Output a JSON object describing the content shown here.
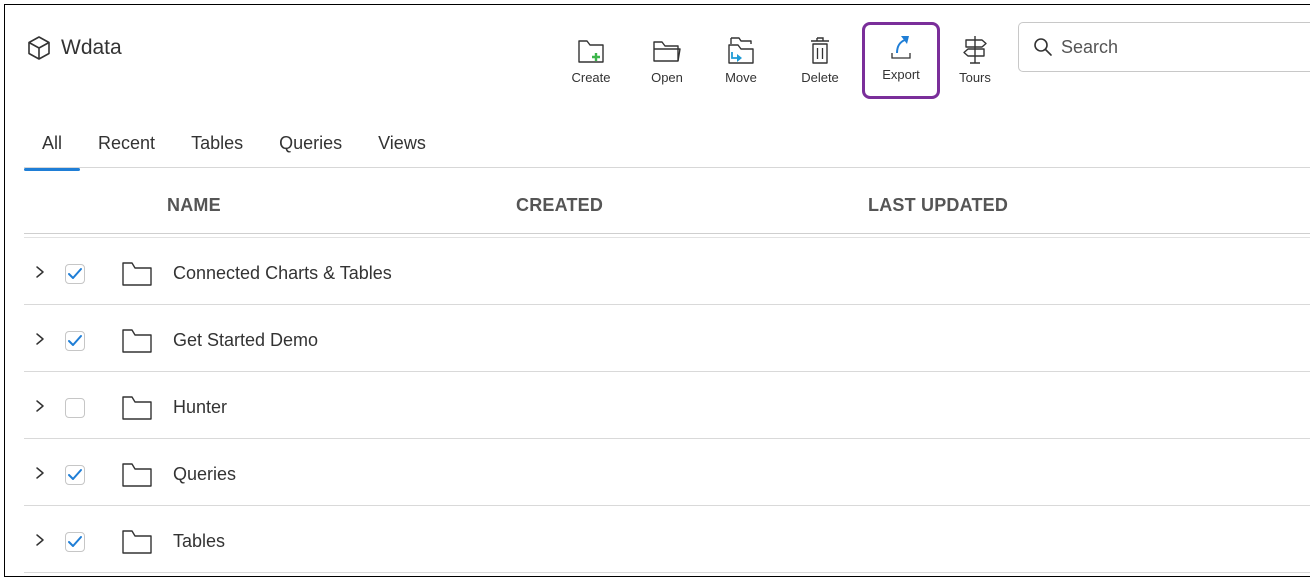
{
  "app": {
    "title": "Wdata",
    "logo_icon": "cube-icon"
  },
  "toolbar": {
    "items": [
      {
        "id": "create",
        "label": "Create",
        "icon": "folder-plus-icon"
      },
      {
        "id": "open",
        "label": "Open",
        "icon": "folder-open-icon"
      },
      {
        "id": "move",
        "label": "Move",
        "icon": "folder-move-icon"
      },
      {
        "id": "delete",
        "label": "Delete",
        "icon": "trash-icon"
      },
      {
        "id": "export",
        "label": "Export",
        "icon": "export-icon",
        "highlighted": true
      },
      {
        "id": "tours",
        "label": "Tours",
        "icon": "signpost-icon"
      }
    ],
    "highlight_color": "#7a2e9a"
  },
  "search": {
    "placeholder": "Search",
    "value": ""
  },
  "tabs": [
    {
      "label": "All",
      "active": true
    },
    {
      "label": "Recent",
      "active": false
    },
    {
      "label": "Tables",
      "active": false
    },
    {
      "label": "Queries",
      "active": false
    },
    {
      "label": "Views",
      "active": false
    }
  ],
  "table": {
    "columns": [
      "NAME",
      "CREATED",
      "LAST UPDATED"
    ],
    "rows": [
      {
        "name": "Connected Charts & Tables",
        "checked": true,
        "created": "",
        "updated": ""
      },
      {
        "name": "Get Started Demo",
        "checked": true,
        "created": "",
        "updated": ""
      },
      {
        "name": "Hunter",
        "checked": false,
        "created": "",
        "updated": ""
      },
      {
        "name": "Queries",
        "checked": true,
        "created": "",
        "updated": ""
      },
      {
        "name": "Tables",
        "checked": true,
        "created": "",
        "updated": ""
      }
    ]
  },
  "colors": {
    "accent": "#1f7ed6",
    "create_plus": "#3bb54a",
    "move_arrow": "#1f9bd6",
    "export_arrow": "#1f7ed6"
  }
}
